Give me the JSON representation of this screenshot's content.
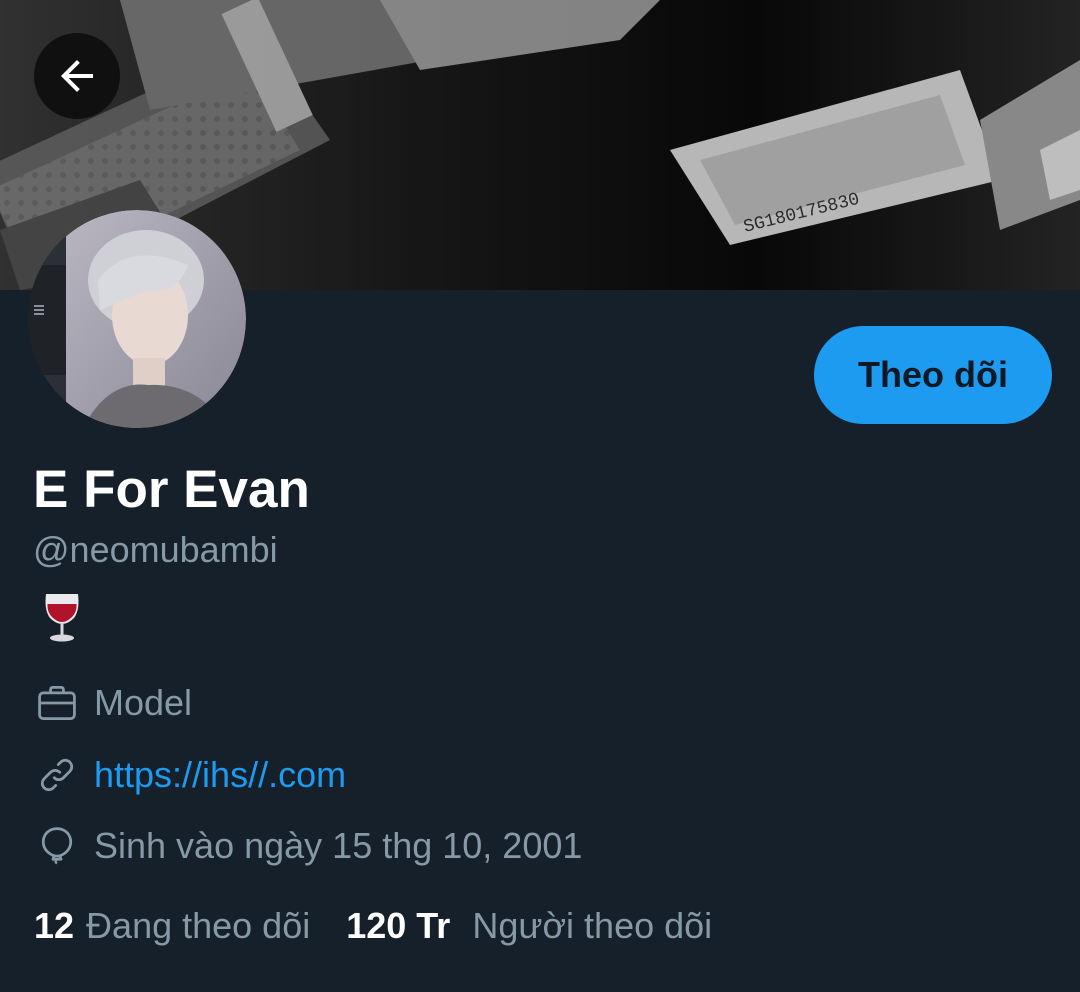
{
  "header": {
    "back_icon": "arrow-left-icon",
    "banner_serial": "SG180175830"
  },
  "profile": {
    "display_name": "E For Evan",
    "handle": "@neomubambi",
    "bio_emoji": "wine-glass-icon",
    "follow_label": "Theo dõi",
    "job": "Model",
    "job_icon": "briefcase-icon",
    "website": "https://ihs//.com",
    "website_icon": "link-icon",
    "birthday": "Sinh vào ngày 15 thg 10, 2001",
    "birthday_icon": "balloon-icon"
  },
  "stats": {
    "following_count": "12",
    "following_label": "Đang theo dõi",
    "followers_count": "120 Tr",
    "followers_label": "Người theo dõi"
  },
  "colors": {
    "background": "#15202b",
    "accent": "#1d9bf0",
    "secondary_text": "#8899a6",
    "primary_text": "#ffffff"
  }
}
